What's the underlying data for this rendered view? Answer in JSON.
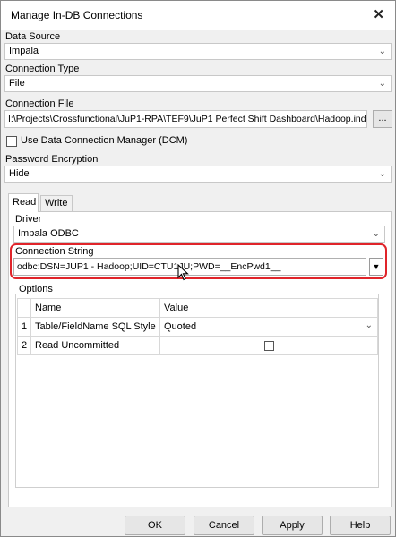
{
  "window": {
    "title": "Manage In-DB Connections",
    "close_glyph": "✕"
  },
  "data_source": {
    "label": "Data Source",
    "value": "Impala"
  },
  "connection_type": {
    "label": "Connection Type",
    "value": "File"
  },
  "connection_file": {
    "label": "Connection File",
    "value": "I:\\Projects\\Crossfunctional\\JuP1-RPA\\TEF9\\JuP1 Perfect Shift Dashboard\\Hadoop.indbc",
    "browse_label": "..."
  },
  "dcm": {
    "label": "Use Data Connection Manager (DCM)",
    "checked": false
  },
  "password_encryption": {
    "label": "Password Encryption",
    "value": "Hide"
  },
  "tabs": [
    {
      "label": "Read"
    },
    {
      "label": "Write"
    }
  ],
  "driver": {
    "label": "Driver",
    "value": "Impala ODBC"
  },
  "connection_string": {
    "label": "Connection String",
    "value": "odbc:DSN=JUP1 - Hadoop;UID=CTU1JU;PWD=__EncPwd1__",
    "dropdown_glyph": "▼"
  },
  "options": {
    "label": "Options",
    "columns": [
      "Name",
      "Value"
    ],
    "rows": [
      {
        "index": "1",
        "name": "Table/FieldName SQL Style",
        "value": "Quoted",
        "type": "combo"
      },
      {
        "index": "2",
        "name": "Read Uncommitted",
        "value": "",
        "type": "checkbox",
        "checked": false
      }
    ]
  },
  "buttons": {
    "ok": "OK",
    "cancel": "Cancel",
    "apply": "Apply",
    "help": "Help"
  },
  "colors": {
    "highlight": "#e0242a",
    "dialog_bg": "#f0f0f0"
  },
  "icons": {
    "combo_arrow": "chevron-down-icon",
    "cursor": "mouse-pointer-icon"
  }
}
